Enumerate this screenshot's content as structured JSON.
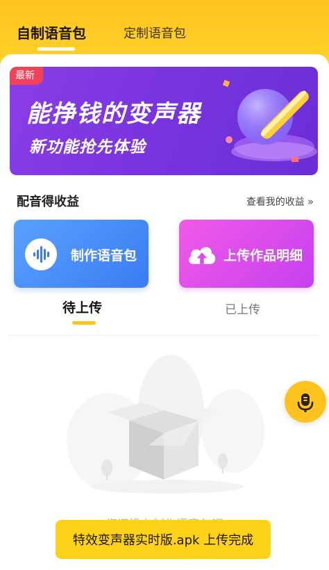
{
  "tabs": {
    "active": "自制语音包",
    "inactive": "定制语音包"
  },
  "banner": {
    "badge": "最新",
    "title": "能挣钱的变声器",
    "subtitle": "新功能抢先体验"
  },
  "earnings": {
    "title": "配音得收益",
    "link": "查看我的收益",
    "chevron_icon": "double-chevron-right-icon"
  },
  "actions": {
    "make_label": "制作语音包",
    "make_icon": "sound-wave-icon",
    "upload_label": "上传作品明细",
    "upload_icon": "cloud-upload-icon"
  },
  "subtabs": {
    "pending": "待上传",
    "uploaded": "已上传"
  },
  "empty": {
    "text": "您还没有制作语音包呢"
  },
  "fab": {
    "icon": "microphone-icon"
  },
  "toast": {
    "text": "特效变声器实时版.apk 上传完成"
  },
  "colors": {
    "accent": "#ffc31d",
    "blue": "#3a7cf2",
    "magenta": "#c640f0",
    "banner_purple": "#7a34df"
  }
}
